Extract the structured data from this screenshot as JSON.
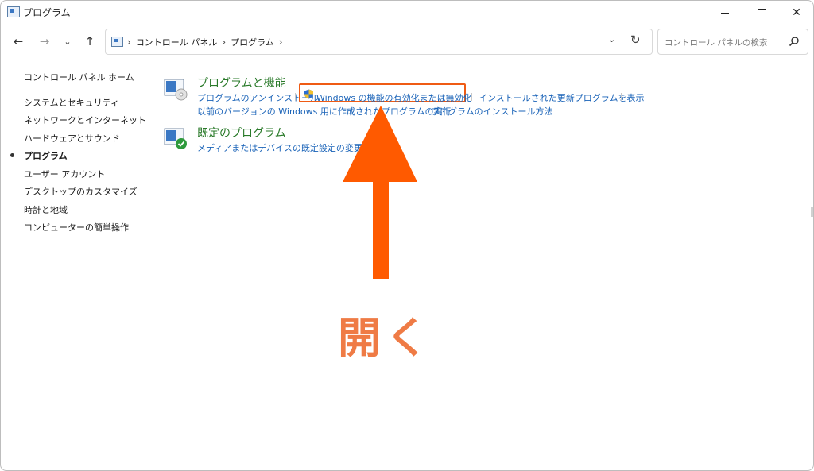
{
  "window": {
    "title": "プログラム"
  },
  "nav": {
    "breadcrumbs": [
      "コントロール パネル",
      "プログラム"
    ],
    "search_placeholder": "コントロール パネルの検索"
  },
  "sidebar": {
    "home": "コントロール パネル ホーム",
    "items": [
      "システムとセキュリティ",
      "ネットワークとインターネット",
      "ハードウェアとサウンド",
      "プログラム",
      "ユーザー アカウント",
      "デスクトップのカスタマイズ",
      "時計と地域",
      "コンピューターの簡単操作"
    ],
    "active_index": 3
  },
  "categories": {
    "programs": {
      "title": "プログラムと機能",
      "links": [
        "プログラムのアンインストール",
        "Windows の機能の有効化または無効化",
        "インストールされた更新プログラムを表示",
        "以前のバージョンの Windows 用に作成されたプログラムの実行",
        "プログラムのインストール方法"
      ]
    },
    "defaults": {
      "title": "既定のプログラム",
      "links": [
        "メディアまたはデバイスの既定設定の変更"
      ]
    }
  },
  "annotation": {
    "text": "開く",
    "color": "#ef7b45",
    "arrow_color": "#ff5a00",
    "highlight_color": "#ef5b14"
  },
  "icons": {
    "back": "arrow-left-icon",
    "forward": "arrow-right-icon",
    "recent": "chevron-down-icon",
    "up": "arrow-up-icon",
    "refresh": "refresh-icon",
    "search": "search-icon",
    "shield": "uac-shield-icon"
  }
}
